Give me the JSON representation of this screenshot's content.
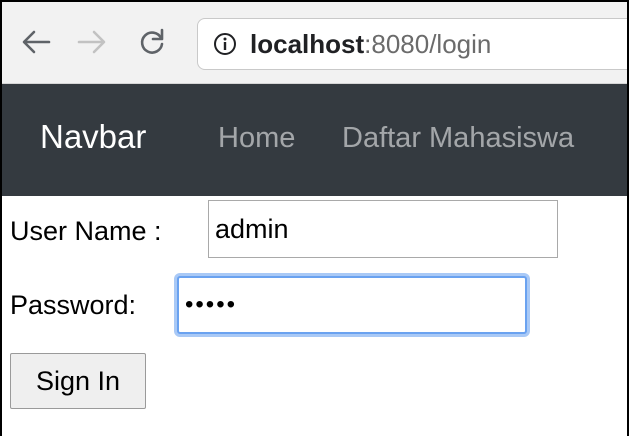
{
  "browser": {
    "url_host": "localhost",
    "url_rest": ":8080/login",
    "icons": {
      "back": "arrow-left-icon",
      "forward": "arrow-right-icon",
      "reload": "reload-icon",
      "info": "info-icon"
    }
  },
  "navbar": {
    "brand": "Navbar",
    "links": [
      {
        "label": "Home"
      },
      {
        "label": "Daftar Mahasiswa"
      }
    ],
    "background": "#343a40",
    "link_color": "rgba(255,255,255,0.55)"
  },
  "form": {
    "username_label": "User Name :",
    "username_value": "admin",
    "password_label": "Password:",
    "password_value": "•••••",
    "submit_label": "Sign In",
    "focus_color": "#6aa2f0"
  }
}
